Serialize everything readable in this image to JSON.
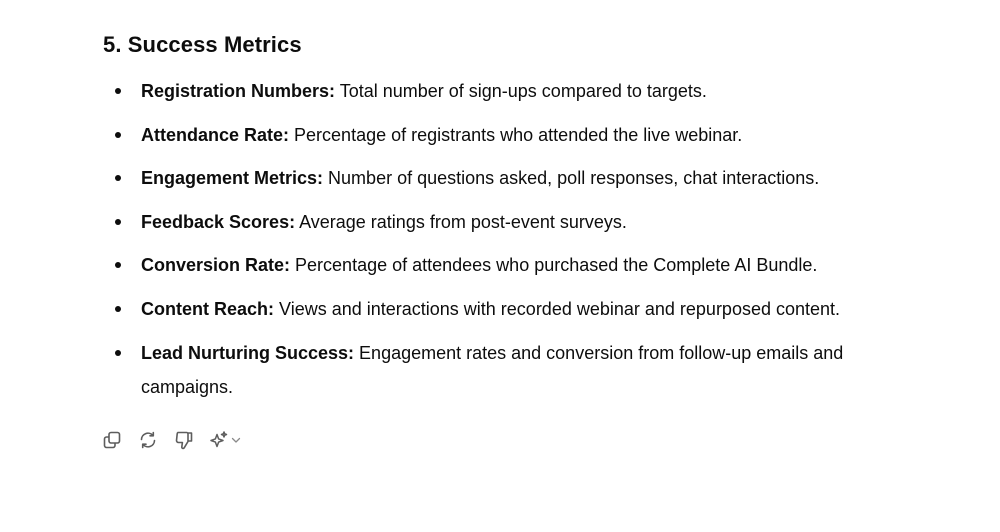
{
  "section": {
    "heading": "5. Success Metrics",
    "metrics": [
      {
        "name": "Registration Numbers:",
        "description": " Total number of sign-ups compared to targets."
      },
      {
        "name": "Attendance Rate:",
        "description": " Percentage of registrants who attended the live webinar."
      },
      {
        "name": "Engagement Metrics:",
        "description": " Number of questions asked, poll responses, chat interactions."
      },
      {
        "name": "Feedback Scores:",
        "description": " Average ratings from post-event surveys."
      },
      {
        "name": "Conversion Rate:",
        "description": " Percentage of attendees who purchased the Complete AI Bundle."
      },
      {
        "name": "Content Reach:",
        "description": " Views and interactions with recorded webinar and repurposed content."
      },
      {
        "name": "Lead Nurturing Success:",
        "description": " Engagement rates and conversion from follow-up emails and campaigns."
      }
    ]
  },
  "actions": {
    "icons": [
      "copy-icon",
      "regenerate-icon",
      "thumbs-down-icon",
      "sparkle-icon",
      "chevron-down-icon"
    ],
    "icon_color": "#5d5d5d"
  }
}
